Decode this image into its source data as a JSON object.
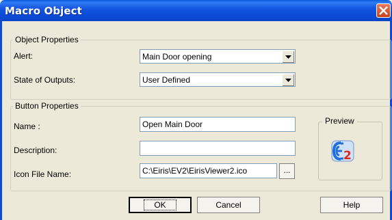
{
  "window": {
    "title": "Macro Object"
  },
  "object_properties": {
    "group_label": "Object Properties",
    "alert_label": "Alert:",
    "alert_value": "Main Door opening",
    "outputs_label": "State of Outputs:",
    "outputs_value": "User Defined"
  },
  "button_properties": {
    "group_label": "Button Properties",
    "name_label": "Name :",
    "name_value": "Open Main Door",
    "description_label": "Description:",
    "description_value": "",
    "icon_label": "Icon File Name:",
    "icon_value": "C:\\Eiris\\EV2\\EirisViewer2.ico",
    "browse_label": "..."
  },
  "preview": {
    "group_label": "Preview",
    "icon_name": "eiris-viewer-icon"
  },
  "buttons": {
    "ok": "OK",
    "cancel": "Cancel",
    "help": "Help"
  },
  "colors": {
    "titlebar": "#0b4bd6",
    "dialog_bg": "#ece9d8",
    "close_red": "#c8421e",
    "icon_blue": "#1e6fd9",
    "icon_red": "#d82a1a"
  }
}
